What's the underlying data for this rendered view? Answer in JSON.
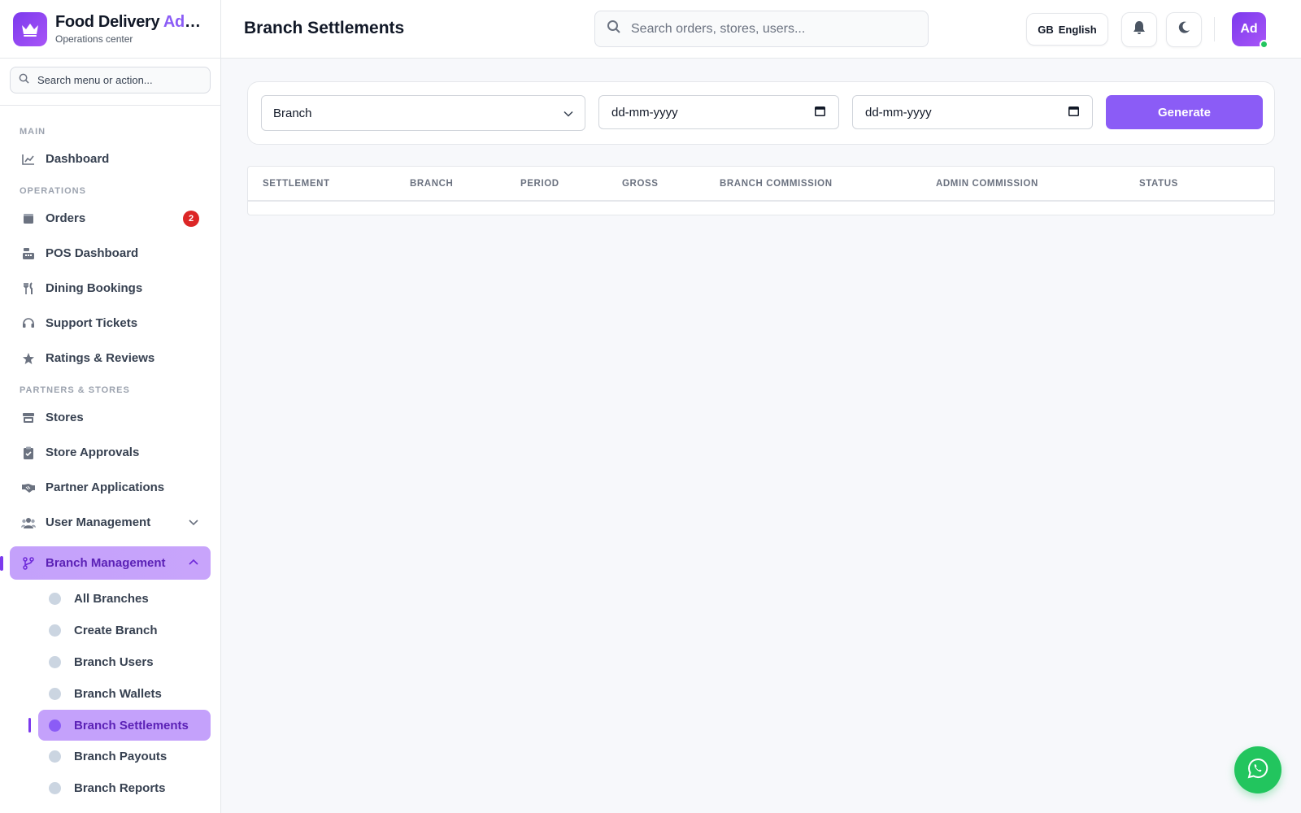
{
  "brand": {
    "title": "Food Delivery ",
    "title_accent": "Admin",
    "subtitle": "Operations center"
  },
  "sidebar": {
    "search_placeholder": "Search menu or action...",
    "sections": {
      "main": "MAIN",
      "operations": "OPERATIONS",
      "partners": "PARTNERS & STORES"
    },
    "items": {
      "dashboard": "Dashboard",
      "orders": "Orders",
      "orders_badge": "2",
      "pos": "POS Dashboard",
      "dining": "Dining Bookings",
      "support": "Support Tickets",
      "ratings": "Ratings & Reviews",
      "stores": "Stores",
      "store_approvals": "Store Approvals",
      "partner_apps": "Partner Applications",
      "user_mgmt": "User Management",
      "branch_mgmt": "Branch Management"
    },
    "branch_sub": {
      "all": "All Branches",
      "create": "Create Branch",
      "users": "Branch Users",
      "wallets": "Branch Wallets",
      "settlements": "Branch Settlements",
      "payouts": "Branch Payouts",
      "reports": "Branch Reports"
    }
  },
  "header": {
    "title": "Branch Settlements",
    "search_placeholder": "Search orders, stores, users...",
    "lang_code": "GB",
    "lang_label": "English",
    "avatar": "Ad"
  },
  "filters": {
    "branch_select": "Branch",
    "date_from": "dd-mm-yyyy",
    "date_to": "dd-mm-yyyy",
    "generate": "Generate"
  },
  "table": {
    "columns": [
      "SETTLEMENT",
      "BRANCH",
      "PERIOD",
      "GROSS",
      "BRANCH COMMISSION",
      "ADMIN COMMISSION",
      "STATUS"
    ],
    "rows": []
  },
  "colors": {
    "accent": "#8b5cf6",
    "active_bg": "#c4a1fb",
    "badge": "#dc2626",
    "whatsapp": "#22c55e"
  },
  "icons": {
    "brand": "crown-icon",
    "dashboard": "chart-line-icon",
    "orders": "box-icon",
    "pos": "cash-register-icon",
    "dining": "utensils-icon",
    "support": "headset-icon",
    "ratings": "star-icon",
    "stores": "store-icon",
    "approvals": "clipboard-check-icon",
    "partners": "handshake-icon",
    "users": "users-icon",
    "branch": "code-branch-icon",
    "bell": "bell-icon",
    "theme": "moon-icon",
    "whatsapp": "whatsapp-icon"
  }
}
